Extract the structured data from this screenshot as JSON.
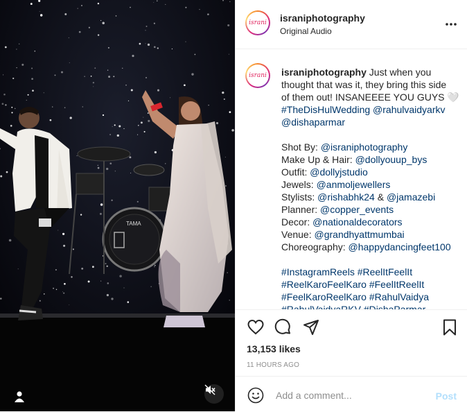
{
  "header": {
    "username": "israniphotography",
    "audio": "Original Audio",
    "avatar_logo": "israni",
    "more_icon": "more-horizontal-icon"
  },
  "caption": {
    "username": "israniphotography",
    "line1_text": "Just when you",
    "line2": "thought that was it, they bring this side",
    "line3": "of them out! INSANEEEE YOU GUYS 🤍",
    "line4_tag1": "#TheDisHulWedding",
    "line4_tag2": "@rahulvaidyarkv",
    "line5_tag": "@dishaparmar",
    "credits": [
      {
        "label": "Shot By:",
        "handle": "@israniphotography"
      },
      {
        "label": "Make Up & Hair:",
        "handle": "@dollyouup_bys"
      },
      {
        "label": "Outfit:",
        "handle": "@dollyjstudio"
      },
      {
        "label": "Jewels:",
        "handle": "@anmoljewellers"
      },
      {
        "label": "Stylists:",
        "handle": "@rishabhk24",
        "joiner": "&",
        "handle2": "@jamazebi"
      },
      {
        "label": "Planner:",
        "handle": "@copper_events"
      },
      {
        "label": "Decor:",
        "handle": "@nationaldecorators"
      },
      {
        "label": "Venue:",
        "handle": "@grandhyattmumbai"
      },
      {
        "label": "Choreography:",
        "handle": "@happydancingfeet100"
      }
    ],
    "hashtags": [
      "#InstagramReels #ReelItFeelIt",
      "#ReelKaroFeelKaro #FeelItReelIt",
      "#FeelKaroReelKaro #RahulVaidya",
      "#RahulVaidyaRKV #DishaParmar"
    ]
  },
  "actions": {
    "likes": "13,153 likes",
    "time": "11 HOURS AGO",
    "icons": [
      "heart-icon",
      "comment-icon",
      "share-icon",
      "bookmark-icon"
    ]
  },
  "comment": {
    "placeholder": "Add a comment...",
    "post_label": "Post",
    "emoji_icon": "emoji-smile-icon"
  },
  "media": {
    "drum_brand": "TAMA",
    "user_icon": "user-tag-icon",
    "mute_icon": "muted-speaker-icon"
  },
  "colors": {
    "link": "#00376b",
    "post_disabled": "#b2dffc",
    "meta_gray": "#8e8e8e"
  }
}
